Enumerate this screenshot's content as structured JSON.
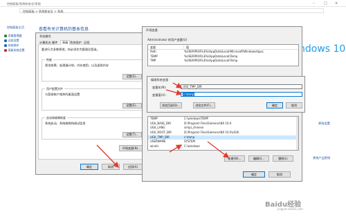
{
  "titlebar": {
    "title": "控制面板\\系统和安全\\系统"
  },
  "breadcrumb": "控制面板 > 系统和安全 > 系统",
  "left_nav": {
    "home": "控制面板主页",
    "items": [
      "设备管理器",
      "远程设置",
      "系统保护",
      "高级系统设置"
    ],
    "item_colors": [
      "#2e7d32",
      "#1565c0",
      "#1565c0",
      "#c62828"
    ]
  },
  "main": {
    "heading": "查看有关计算机的基本信息",
    "windows_logo": "ndows 10",
    "right_links": [
      "更改设置",
      "更改产品密钥"
    ]
  },
  "sysprops": {
    "title": "系统属性",
    "tabs": [
      "计算机名",
      "硬件",
      "高级",
      "系统保护",
      "远程"
    ],
    "note": "要进行大多数更改，你必须作为管理员登录。",
    "groups": [
      {
        "label": "性能",
        "desc": "视觉效果，处理器计划，内存使用，以及虚拟内存",
        "button": "设置(S)..."
      },
      {
        "label": "用户配置文件",
        "desc": "与登录帐户相关的桌面设置",
        "button": "设置(E)..."
      },
      {
        "label": "启动和故障恢复",
        "desc": "系统启动、系统故障和调试信息",
        "button": "设置(T)..."
      }
    ],
    "env_button": "环境变量(N)...",
    "ok": "确定",
    "cancel": "取消",
    "apply": "应用(A)"
  },
  "envvars": {
    "title": "环境变量",
    "user_label": "Administrator 的用户变量(U)",
    "headers": [
      "变量",
      "值"
    ],
    "user_rows": [
      {
        "name": "Path",
        "value": "%USERPROFILE%\\AppData\\Local\\Microsoft\\WindowsApps;"
      },
      {
        "name": "TEMP",
        "value": "%USERPROFILE%\\AppData\\Local\\Temp"
      },
      {
        "name": "TMP",
        "value": "%USERPROFILE%\\AppData\\Local\\Temp"
      }
    ],
    "sys_rows": [
      {
        "name": "TEMP",
        "value": "C:\\windows\\TEMP"
      },
      {
        "name": "UGII_BASE_DIR",
        "value": "D:\\Program Files\\Siemens\\NX 10.0"
      },
      {
        "name": "UGII_LANG",
        "value": "simpl_chinese"
      },
      {
        "name": "UGII_ROOT_DIR",
        "value": "D:\\Program Files\\Siemens\\NX 10.0\\UGII\\"
      },
      {
        "name": "UGII_TMP_DIR",
        "value": "c:\\temp"
      },
      {
        "name": "USERNAME",
        "value": "SYSTEM"
      },
      {
        "name": "windir",
        "value": "C:\\windows"
      }
    ],
    "sys_buttons": [
      "新建(W)...",
      "编辑(I)...",
      "删除(L)"
    ],
    "ok": "确定",
    "cancel": "取消"
  },
  "editdlg": {
    "title": "编辑系统变量",
    "name_label": "变量名(N):",
    "name_value": "UGII_TMP_DIR",
    "value_label": "变量值(V):",
    "value_value": "c:\\temp",
    "browse_dir": "浏览目录(D)...",
    "browse_file": "浏览文件(F)...",
    "ok": "确定",
    "cancel": "取消"
  },
  "watermark": "Baidu经验",
  "watermark_sub": "jingyan.baidu.com"
}
